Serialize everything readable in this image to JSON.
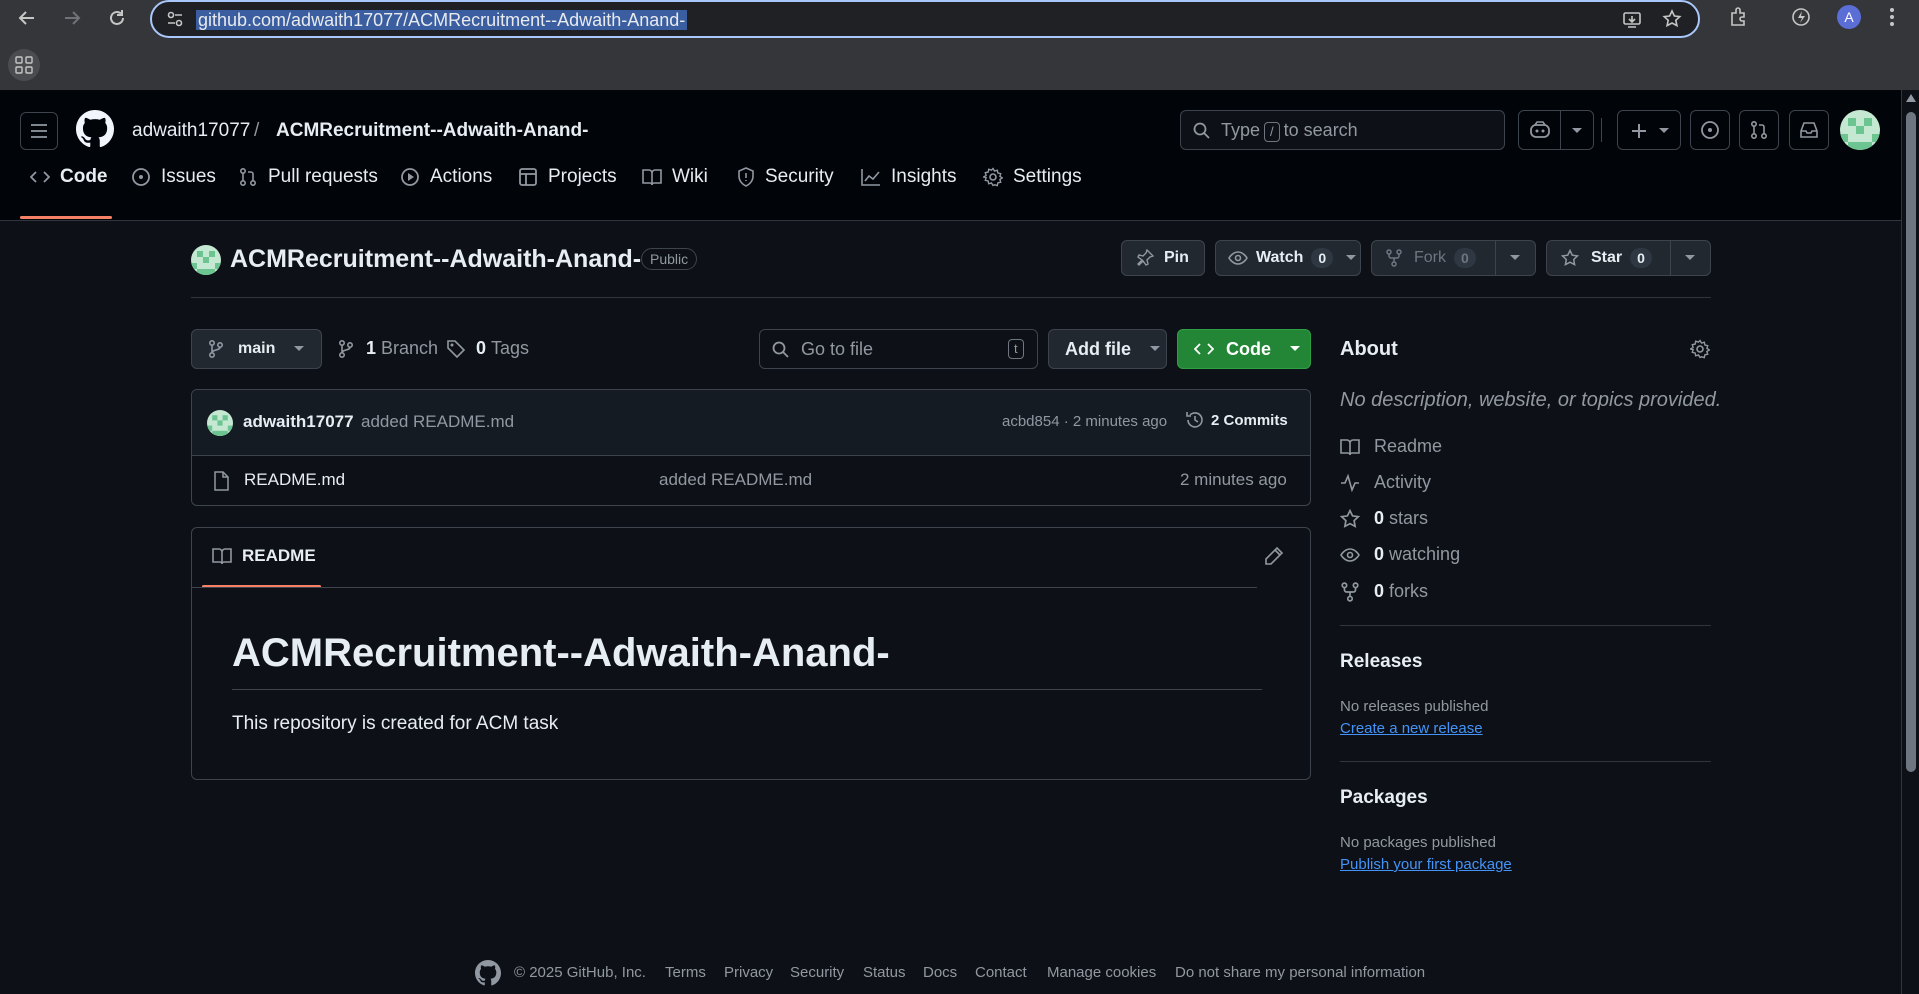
{
  "browser": {
    "url": "github.com/adwaith17077/ACMRecruitment--Adwaith-Anand-",
    "profile_initial": "A"
  },
  "header": {
    "owner": "adwaith17077",
    "separator": "/",
    "repo": "ACMRecruitment--Adwaith-Anand-",
    "search_prefix": "Type",
    "search_key": "/",
    "search_suffix": "to search"
  },
  "nav": {
    "code": "Code",
    "issues": "Issues",
    "pulls": "Pull requests",
    "actions": "Actions",
    "projects": "Projects",
    "wiki": "Wiki",
    "security": "Security",
    "insights": "Insights",
    "settings": "Settings"
  },
  "repo": {
    "title": "ACMRecruitment--Adwaith-Anand-",
    "visibility": "Public",
    "pin": "Pin",
    "watch": "Watch",
    "watch_count": "0",
    "fork": "Fork",
    "fork_count": "0",
    "star": "Star",
    "star_count": "0"
  },
  "toolbar": {
    "branch": "main",
    "branch_count": "1",
    "branch_label": "Branch",
    "tag_count": "0",
    "tag_label": "Tags",
    "go_to_file_placeholder": "Go to file",
    "go_to_file_key": "t",
    "add_file": "Add file",
    "code": "Code"
  },
  "commit": {
    "author": "adwaith17077",
    "message": "added README.md",
    "sha_time": "acbd854 · 2 minutes ago",
    "commits_count": "2 Commits"
  },
  "files": [
    {
      "name": "README.md",
      "message": "added README.md",
      "time": "2 minutes ago"
    }
  ],
  "readme": {
    "tab": "README",
    "heading": "ACMRecruitment--Adwaith-Anand-",
    "body": "This repository is created for ACM task"
  },
  "about": {
    "title": "About",
    "description": "No description, website, or topics provided.",
    "readme": "Readme",
    "activity": "Activity",
    "stars_count": "0",
    "stars_label": "stars",
    "watching_count": "0",
    "watching_label": "watching",
    "forks_count": "0",
    "forks_label": "forks"
  },
  "releases": {
    "title": "Releases",
    "empty": "No releases published",
    "link": "Create a new release"
  },
  "packages": {
    "title": "Packages",
    "empty": "No packages published",
    "link": "Publish your first package"
  },
  "footer": {
    "copyright": "© 2025 GitHub, Inc.",
    "links": [
      "Terms",
      "Privacy",
      "Security",
      "Status",
      "Docs",
      "Contact",
      "Manage cookies",
      "Do not share my personal information"
    ]
  },
  "colors": {
    "accent_green": "#238636",
    "nav_underline": "#f78166",
    "link": "#4493f8"
  }
}
